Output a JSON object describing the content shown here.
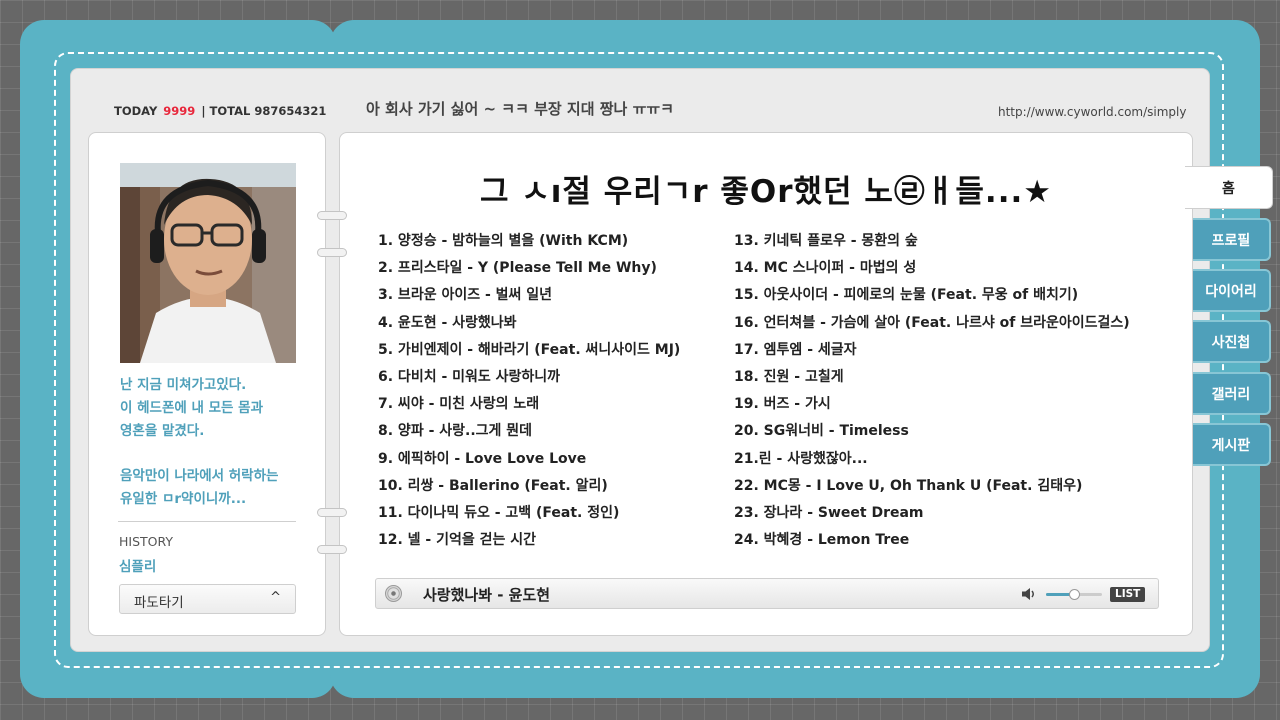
{
  "header": {
    "today_label": "TODAY",
    "today_count": "9999",
    "total_label": "| TOTAL",
    "total_count": "987654321",
    "title": "아 회사 가기 싫어 ~ ㅋㅋ 부장 지대 짱나 ㅠㅠㅋ",
    "url": "http://www.cyworld.com/simply"
  },
  "profile": {
    "intro_lines": [
      "난 지금 미쳐가고있다.",
      "이 헤드폰에 내 모든 몸과",
      "영혼을 맡겼다.",
      "음악만이 나라에서 허락하는",
      "유일한 ㅁr약이니까..."
    ],
    "history_label": "HISTORY",
    "history_name": "심플리",
    "history_select": "파도타기",
    "history_chevron": "^"
  },
  "main": {
    "heading": "그 ㅅı절 우리ㄱr 좋Or했던 노㉣ㅐ들...★",
    "songs_left": [
      "1. 양정승 - 밤하늘의 별을 (With KCM)",
      "2. 프리스타일 - Y (Please Tell Me Why)",
      "3. 브라운 아이즈 - 벌써 일년",
      "4. 윤도현 - 사랑했나봐",
      "5. 가비엔제이 - 해바라기 (Feat. 써니사이드 MJ)",
      "6. 다비치 - 미워도 사랑하니까",
      "7. 씨야 - 미친 사랑의 노래",
      "8. 양파 - 사랑..그게 뭔데",
      "9. 에픽하이 - Love Love Love",
      "10. 리쌍 - Ballerino (Feat. 알리)",
      "11. 다이나믹 듀오 - 고백 (Feat. 정인)",
      "12. 넬 - 기억을 걷는 시간"
    ],
    "songs_right": [
      "13. 키네틱 플로우 - 몽환의 숲",
      "14. MC 스나이퍼 - 마법의 성",
      "15. 아웃사이더 - 피에로의 눈물 (Feat. 무웅 of 배치기)",
      "16. 언터쳐블 - 가슴에 살아 (Feat. 나르샤 of 브라운아이드걸스)",
      "17. 엠투엠 - 세글자",
      "18. 진원 - 고칠게",
      "19. 버즈 - 가시",
      "20. SG워너비 - Timeless",
      "21.린 - 사랑했잖아...",
      "22. MC몽 - I Love U, Oh Thank U (Feat. 김태우)",
      "23. 장나라 - Sweet Dream",
      "24. 박혜경 - Lemon Tree"
    ]
  },
  "player": {
    "now_playing": "사랑했나봐  -  윤도현",
    "list_label": "LIST",
    "volume": 0.5,
    "disc_icon": "cd-disc-icon",
    "speaker_icon": "speaker-icon"
  },
  "tabs": [
    {
      "label": "홈",
      "active": true
    },
    {
      "label": "프로필",
      "active": false
    },
    {
      "label": "다이어리",
      "active": false
    },
    {
      "label": "사진첩",
      "active": false
    },
    {
      "label": "갤러리",
      "active": false
    },
    {
      "label": "게시판",
      "active": false
    }
  ],
  "colors": {
    "frame": "#5ab3c5",
    "accent": "#4fa0ba",
    "today_count": "#e8283c"
  }
}
